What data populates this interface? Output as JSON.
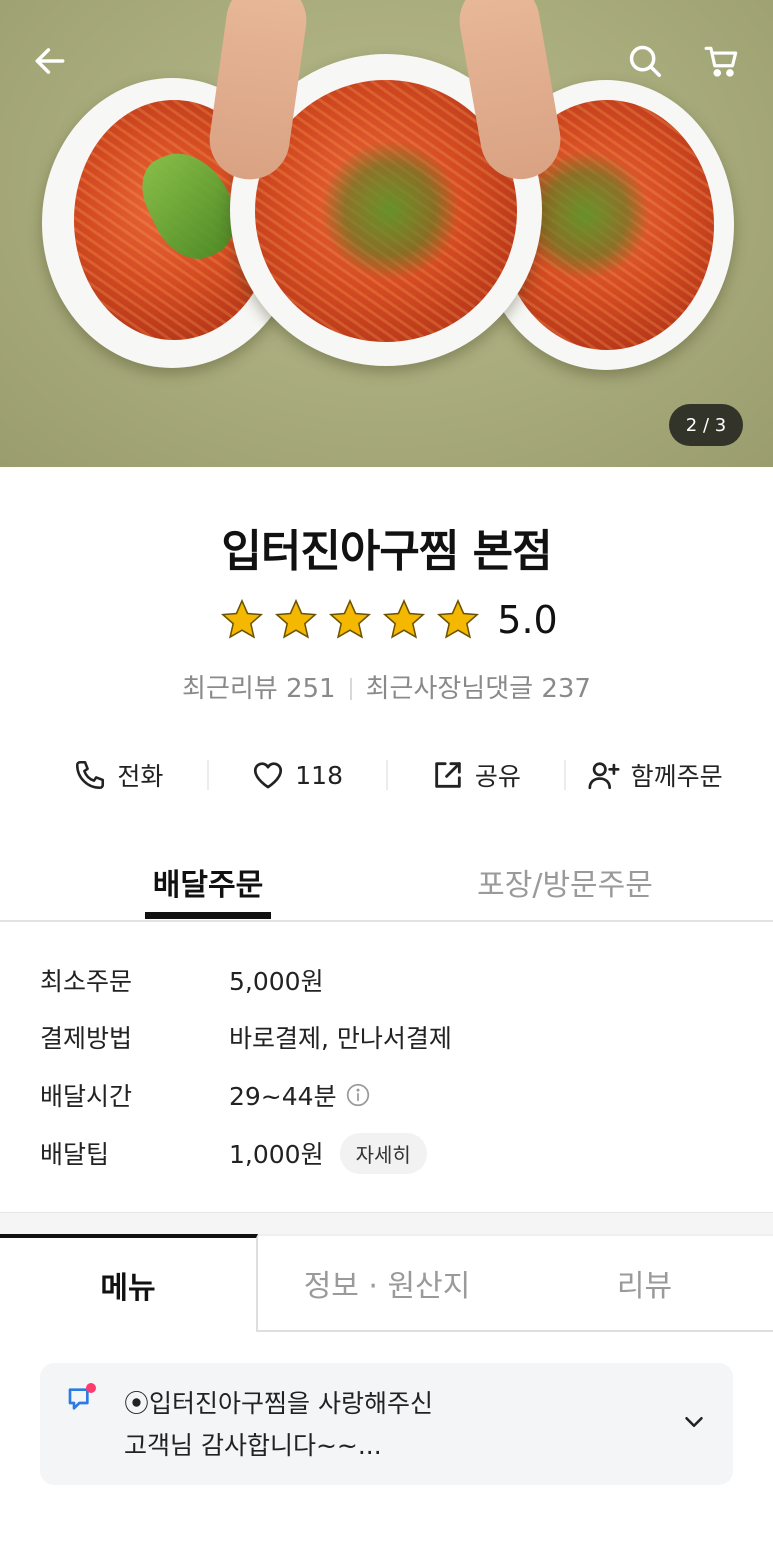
{
  "hero": {
    "image_counter": "2 / 3",
    "icons": {
      "back": "back-arrow-icon",
      "search": "search-icon",
      "cart": "cart-icon"
    }
  },
  "store": {
    "name": "입터진아구찜 본점",
    "rating": "5.0",
    "stars": 5,
    "recent_reviews": "최근리뷰 251",
    "recent_owner_comments": "최근사장님댓글 237"
  },
  "actions": {
    "call": "전화",
    "likes": "118",
    "share": "공유",
    "group_order": "함께주문"
  },
  "order_tabs": {
    "delivery": "배달주문",
    "pickup": "포장/방문주문"
  },
  "info": {
    "min_order_label": "최소주문",
    "min_order_value": "5,000원",
    "payment_label": "결제방법",
    "payment_value": "바로결제, 만나서결제",
    "delivery_time_label": "배달시간",
    "delivery_time_value": "29~44분",
    "delivery_tip_label": "배달팁",
    "delivery_tip_value": "1,000원",
    "detail_button": "자세히"
  },
  "content_tabs": {
    "menu": "메뉴",
    "info_origin": "정보 · 원산지",
    "review": "리뷰"
  },
  "notice": {
    "text": "⦿입터진아구찜을  사랑해주신\n   고객님  감사합니다~~..."
  },
  "colors": {
    "star": "#F5B800",
    "notice_dot": "#FF3A6F",
    "notice_icon": "#2C7BE5"
  }
}
